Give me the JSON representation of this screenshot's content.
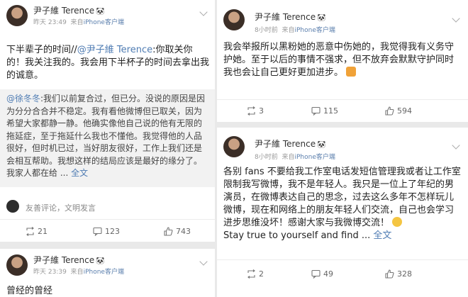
{
  "posts": [
    {
      "user": "尹子維 Terence",
      "verify_icon": "panda-badge",
      "time": "昨天 23:49",
      "source_prefix": "来自",
      "source": "iPhone客户端",
      "text_before": "下半辈子的时间",
      "repost_mark": "//",
      "mention": "@尹子維 Terence",
      "text_after": ":你取关你的！我关注我的。我会用下半杯子的时间去拿出我的诚意。",
      "quote_mention": "@徐冬冬",
      "quote_text": ":我们以前复合过，但已分。没说的原因是因为分分合合并不稳定。我有看他微博但已取关，因为希望大家都静一静。他确实像他自己说的他有无限的拖延症，至于拖延什么我也不懂他。我觉得他的人品很好，但时机已过，当好朋友很好，工作上我们还是会相互帮助。我想这样的结局应该是最好的缘分了。我家人都在给 ...",
      "quote_more": "全文",
      "comment_placeholder": "友善评论，文明发言",
      "reposts": "21",
      "comments": "123",
      "likes": "743"
    },
    {
      "user": "尹子維 Terence",
      "time": "昨天 23:39",
      "source_prefix": "来自",
      "source": "iPhone客户端",
      "text": "曾经的曾经"
    },
    {
      "user": "尹子維 Terence",
      "time": "8小时前",
      "source_prefix": "来自",
      "source": "iPhone客户端",
      "text": "我会举报所以黑粉她的恶意中伤她的，我觉得我有义务守护她。至于以后的事情不强求，但不放弃会默默守护同时我也会让自己更好更加进步。",
      "emoji": "fist-emoji",
      "reposts": "3",
      "comments": "115",
      "likes": "594"
    },
    {
      "user": "尹子維 Terence",
      "time": "8小时前",
      "source_prefix": "来自",
      "source": "iPhone客户端",
      "text": "各别 fans 不要给我工作室电话发短信管理我或者让工作室限制我写微博，我不是年轻人。我只是一位上了年纪的男演员，在微博表达自己的思念，过去这么多年不怎样玩儿微博，现在和网络上的朋友年轻人们交流，自己也会学习进步思维没坏！感谢大家与我微博交流！",
      "text_tail": "Stay true to yourself and find ...",
      "more": "全文",
      "reposts": "2",
      "comments": "49",
      "likes": "328"
    }
  ]
}
